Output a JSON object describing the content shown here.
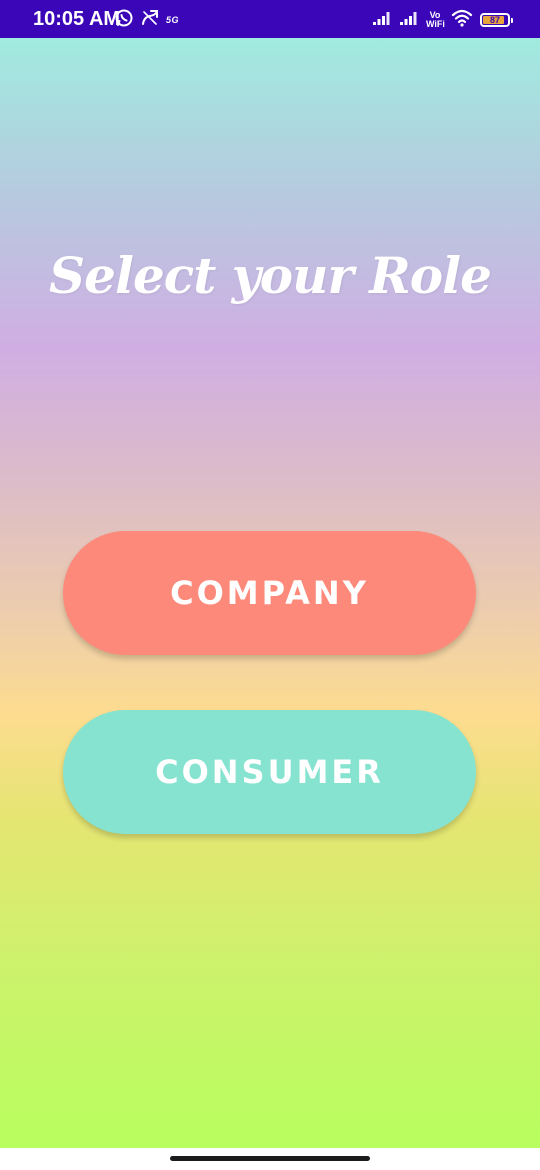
{
  "status_bar": {
    "time": "10:05 AM",
    "network_label": "5G",
    "vowifi_top": "Vo",
    "vowifi_bottom": "WiFi",
    "battery_level": "87",
    "battery_fraction": 0.87,
    "icons": [
      "whatsapp-icon",
      "missed-call-icon",
      "signal-icon",
      "signal-icon",
      "wifi-icon",
      "battery-icon"
    ],
    "background": "#3a06b8"
  },
  "main": {
    "title": "Select your Role",
    "buttons": {
      "company_label": "COMPANY",
      "consumer_label": "CONSUMER"
    },
    "colors": {
      "company": "#fd897a",
      "consumer": "#85e3d0",
      "gradient_top": "#a0ebdf",
      "gradient_bottom": "#b8fe5e"
    }
  }
}
